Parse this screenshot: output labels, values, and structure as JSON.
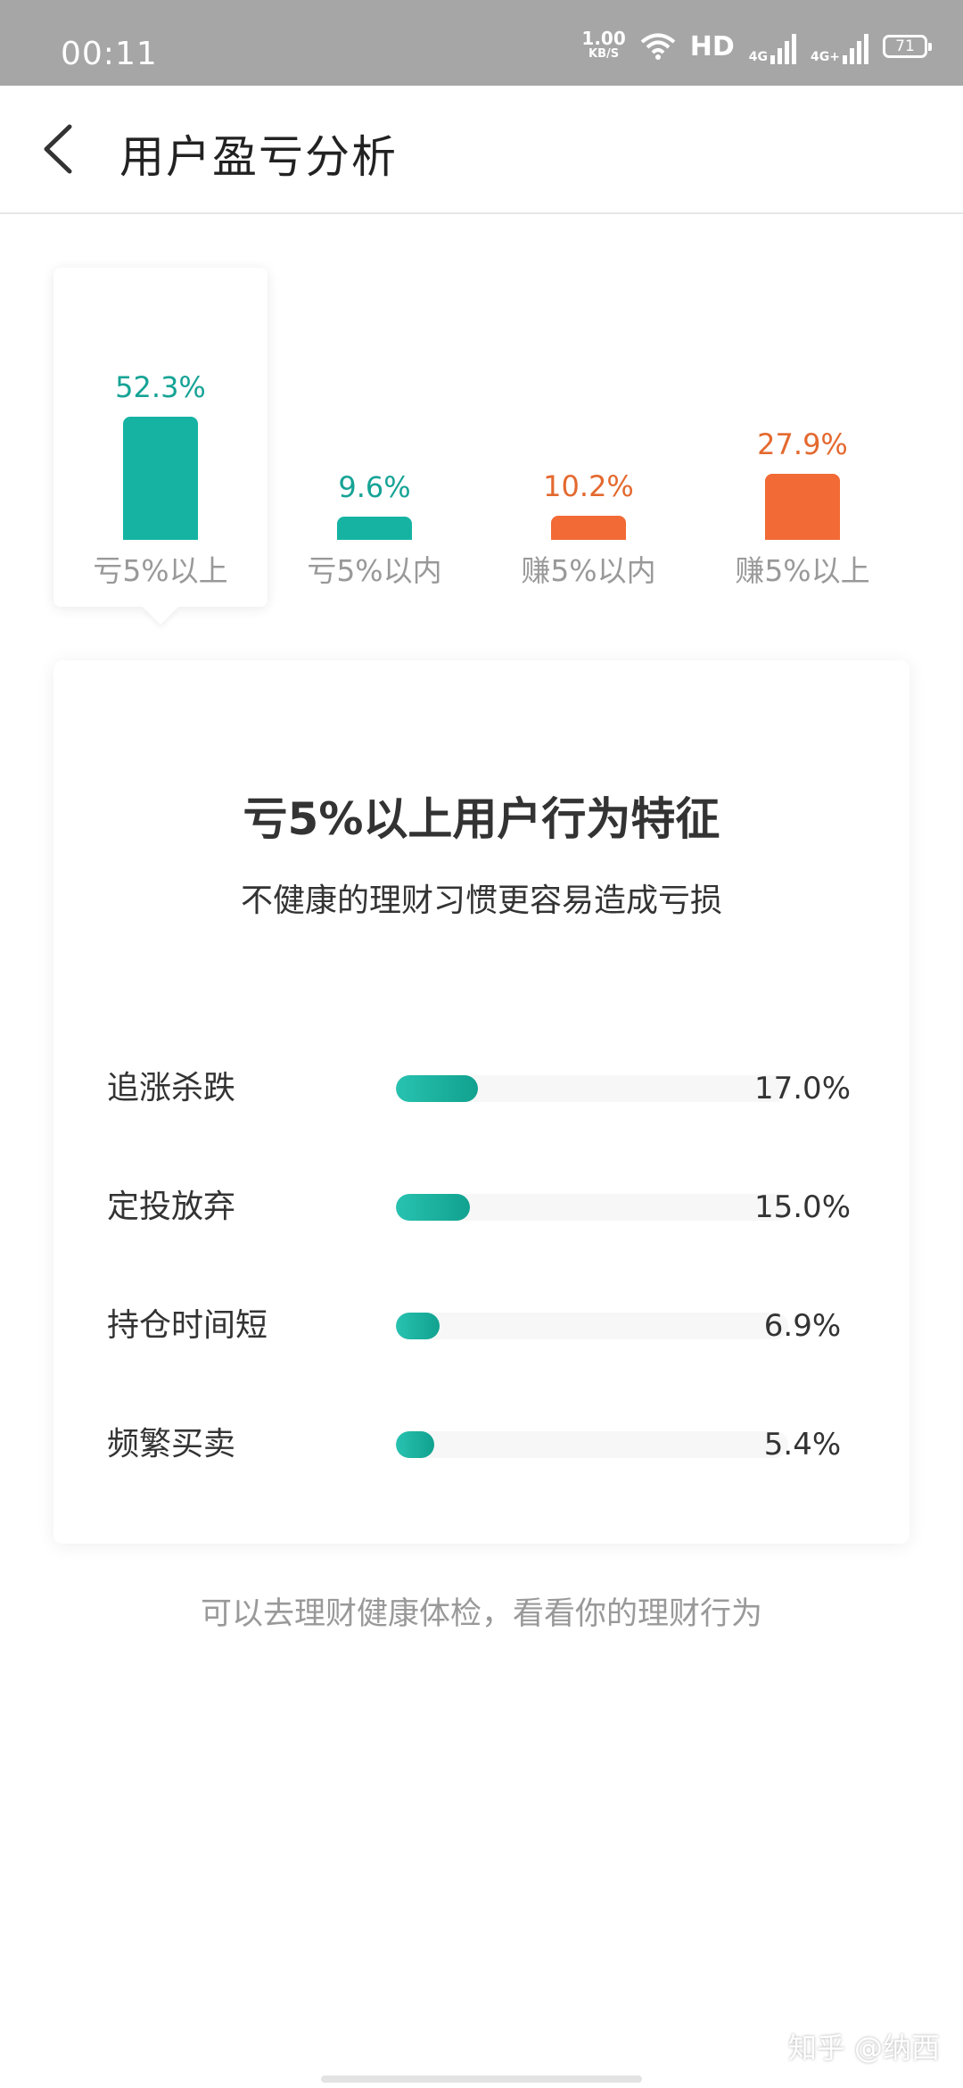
{
  "status_bar": {
    "time": "00:11",
    "net_speed": "1.00",
    "net_unit": "KB/S",
    "hd_label": "HD",
    "signal1_label": "4G",
    "signal2_label": "4G+",
    "battery": "71"
  },
  "header": {
    "title": "用户盈亏分析"
  },
  "chart_data": {
    "type": "bar",
    "categories": [
      "亏5%以上",
      "亏5%以内",
      "赚5%以内",
      "赚5%以上"
    ],
    "values": [
      52.3,
      9.6,
      10.2,
      27.9
    ],
    "value_labels": [
      "52.3%",
      "9.6%",
      "10.2%",
      "27.9%"
    ],
    "colors": [
      "#16b3a3",
      "#16b3a3",
      "#f26a35",
      "#f26a35"
    ],
    "value_colors": [
      "#16a396",
      "#16a396",
      "#e4692f",
      "#e4692f"
    ],
    "ylim": [
      0,
      52.3
    ],
    "selected_index": 0
  },
  "card": {
    "title": "亏5%以上用户行为特征",
    "subtitle": "不健康的理财习惯更容易造成亏损",
    "rows": [
      {
        "label": "追涨杀跌",
        "value": 17.0,
        "value_label": "17.0%"
      },
      {
        "label": "定投放弃",
        "value": 15.0,
        "value_label": "15.0%"
      },
      {
        "label": "持仓时间短",
        "value": 6.9,
        "value_label": "6.9%"
      },
      {
        "label": "频繁买卖",
        "value": 5.4,
        "value_label": "5.4%"
      }
    ]
  },
  "footer": {
    "link_text": "可以去理财健康体检，看看你的理财行为"
  },
  "watermark": "知乎 @纳西",
  "colors": {
    "accent_teal": "#16b3a3",
    "accent_orange": "#f26a35",
    "status_bar": "#a6a6a6"
  }
}
